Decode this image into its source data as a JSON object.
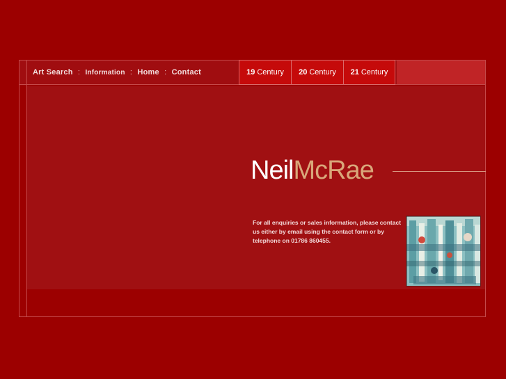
{
  "nav": {
    "art_search": "Art Search",
    "information": "Information",
    "home": "Home",
    "contact": "Contact",
    "separator": ":"
  },
  "century_tabs": [
    {
      "number": "19",
      "label": "Century"
    },
    {
      "number": "20",
      "label": "Century"
    },
    {
      "number": "21",
      "label": "Century"
    }
  ],
  "brand": {
    "first_name": "Neil",
    "last_name": "McRae"
  },
  "enquiry_text": "For all enquiries or sales information, please contact us either by email using the contact form or by telephone on 01786 860455.",
  "colors": {
    "background": "#9c0000",
    "panel": "#a01012",
    "tab": "#c50a0a",
    "brand_accent": "#d9a77a"
  },
  "icons": {
    "artwork": "painting-thumbnail"
  }
}
